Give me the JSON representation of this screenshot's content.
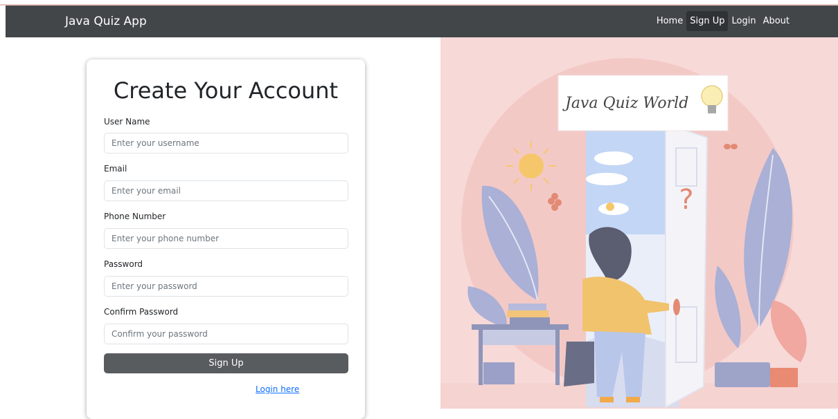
{
  "navbar": {
    "brand": "Java Quiz App",
    "links": [
      "Home",
      "Sign Up",
      "Login",
      "About"
    ],
    "active": "Sign Up"
  },
  "form": {
    "title": "Create Your Account",
    "fields": [
      {
        "label": "User Name",
        "placeholder": "Enter your username"
      },
      {
        "label": "Email",
        "placeholder": "Enter your email"
      },
      {
        "label": "Phone Number",
        "placeholder": "Enter your phone number"
      },
      {
        "label": "Password",
        "placeholder": "Enter your password"
      },
      {
        "label": "Confirm Password",
        "placeholder": "Confirm your password"
      }
    ],
    "submit_label": "Sign Up",
    "login_link": "Login here"
  },
  "illustration": {
    "sign_text": "Java Quiz World",
    "door_symbol": "?"
  },
  "colors": {
    "navbar_bg": "#424649",
    "button_bg": "#595c5f",
    "link": "#0d6efd",
    "illustration_bg": "#f7d9d8"
  }
}
